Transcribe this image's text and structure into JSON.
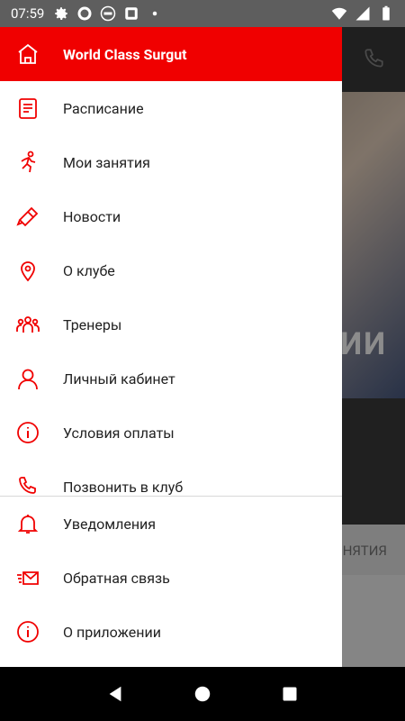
{
  "status_bar": {
    "time": "07:59"
  },
  "background": {
    "banner_text": "ИИ",
    "tab_label": "НЯТИЯ"
  },
  "drawer": {
    "title": "World Class Surgut",
    "items": [
      {
        "label": "Расписание",
        "icon": "schedule-icon"
      },
      {
        "label": "Мои занятия",
        "icon": "running-person-icon"
      },
      {
        "label": "Новости",
        "icon": "megaphone-icon"
      },
      {
        "label": "О клубе",
        "icon": "location-pin-icon"
      },
      {
        "label": "Тренеры",
        "icon": "people-icon"
      },
      {
        "label": "Личный кабинет",
        "icon": "user-profile-icon"
      },
      {
        "label": "Условия оплаты",
        "icon": "info-icon"
      },
      {
        "label": "Позвонить в клуб",
        "icon": "phone-icon"
      }
    ],
    "bottom_items": [
      {
        "label": "Уведомления",
        "icon": "bell-icon"
      },
      {
        "label": "Обратная связь",
        "icon": "envelope-icon"
      },
      {
        "label": "О приложении",
        "icon": "info-icon"
      }
    ]
  },
  "colors": {
    "accent": "#f00000",
    "statusbar": "#5e5e5e"
  }
}
